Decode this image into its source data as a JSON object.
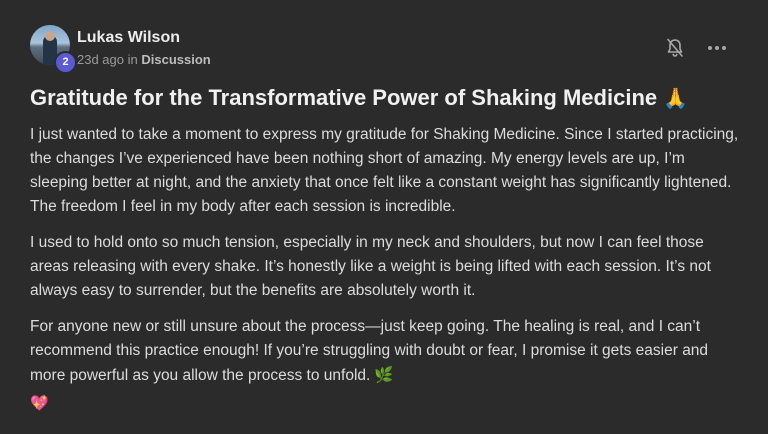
{
  "author": {
    "name": "Lukas Wilson",
    "level": "2",
    "time_ago": "23d ago",
    "in_label": "in",
    "category": "Discussion"
  },
  "actions": {
    "notify_icon": "bell-off-icon",
    "more_icon": "more-horizontal-icon"
  },
  "post": {
    "title": "Gratitude for the Transformative Power of Shaking Medicine",
    "title_emoji": "🙏",
    "paragraphs": [
      "I just wanted to take a moment to express my gratitude for Shaking Medicine. Since I started practicing, the changes I’ve experienced have been nothing short of amazing. My energy levels are up, I’m sleeping better at night, and the anxiety that once felt like a constant weight has significantly lightened. The freedom I feel in my body after each session is incredible.",
      "I used to hold onto so much tension, especially in my neck and shoulders, but now I can feel those areas releasing with every shake. It’s honestly like a weight is being lifted with each session. It’s not always easy to surrender, but the benefits are absolutely worth it.",
      "For anyone new or still unsure about the process—just keep going. The healing is real, and I can’t recommend this practice enough! If you’re struggling with doubt or fear, I promise it gets easier and more powerful as you allow the process to unfold."
    ],
    "leaf_emoji": "🌿",
    "heart_emoji": "💖"
  },
  "colors": {
    "background": "#2b2b2b",
    "badge": "#5b5ad6",
    "text": "#dcdcdc",
    "muted": "#9a9a9a"
  }
}
